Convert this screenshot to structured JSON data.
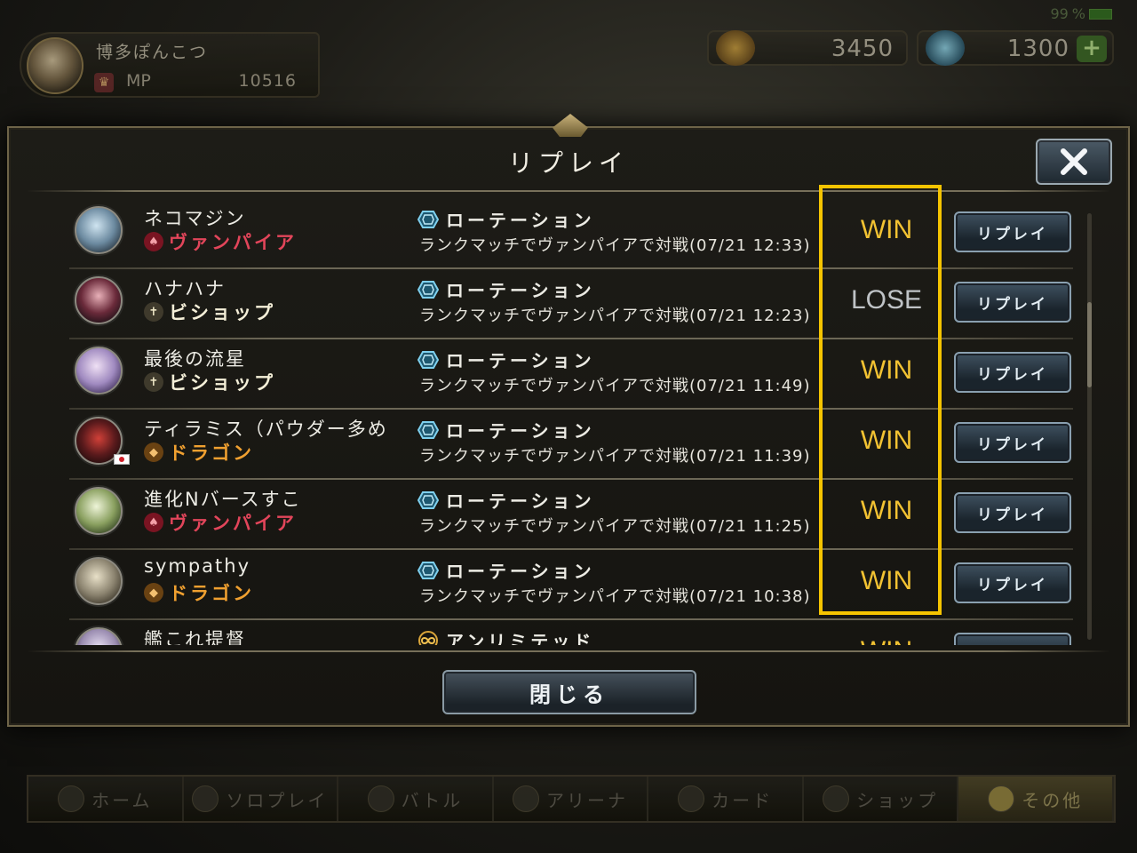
{
  "status": {
    "battery_percent": "99"
  },
  "profile": {
    "name": "博多ぽんこつ",
    "mp_label": "MP",
    "mp_value": "10516"
  },
  "currency": {
    "gold": "3450",
    "crystal": "1300",
    "plus": "+"
  },
  "modal": {
    "title": "リプレイ",
    "close_label": "閉じる",
    "rows": [
      {
        "player": "ネコマジン",
        "class_label": "ヴァンパイア",
        "class_type": "vampire",
        "format_label": "ローテーション",
        "format_type": "rotation",
        "description": "ランクマッチでヴァンパイアで対戦(07/21 12:33)",
        "result": "WIN",
        "replay_label": "リプレイ",
        "flag": false
      },
      {
        "player": "ハナハナ",
        "class_label": "ビショップ",
        "class_type": "bishop",
        "format_label": "ローテーション",
        "format_type": "rotation",
        "description": "ランクマッチでヴァンパイアで対戦(07/21 12:23)",
        "result": "LOSE",
        "replay_label": "リプレイ",
        "flag": false
      },
      {
        "player": "最後の流星",
        "class_label": "ビショップ",
        "class_type": "bishop",
        "format_label": "ローテーション",
        "format_type": "rotation",
        "description": "ランクマッチでヴァンパイアで対戦(07/21 11:49)",
        "result": "WIN",
        "replay_label": "リプレイ",
        "flag": false
      },
      {
        "player": "ティラミス（パウダー多め",
        "class_label": "ドラゴン",
        "class_type": "dragon",
        "format_label": "ローテーション",
        "format_type": "rotation",
        "description": "ランクマッチでヴァンパイアで対戦(07/21 11:39)",
        "result": "WIN",
        "replay_label": "リプレイ",
        "flag": true
      },
      {
        "player": "進化Nバースすこ",
        "class_label": "ヴァンパイア",
        "class_type": "vampire",
        "format_label": "ローテーション",
        "format_type": "rotation",
        "description": "ランクマッチでヴァンパイアで対戦(07/21 11:25)",
        "result": "WIN",
        "replay_label": "リプレイ",
        "flag": false
      },
      {
        "player": "sympathy",
        "class_label": "ドラゴン",
        "class_type": "dragon",
        "format_label": "ローテーション",
        "format_type": "rotation",
        "description": "ランクマッチでヴァンパイアで対戦(07/21 10:38)",
        "result": "WIN",
        "replay_label": "リプレイ",
        "flag": false
      },
      {
        "player": "艦これ提督",
        "class_label": "",
        "class_type": "",
        "format_label": "アンリミテッド",
        "format_type": "unlimited",
        "description": "",
        "result": "WIN",
        "replay_label": "リプレイ",
        "flag": false
      }
    ]
  },
  "bottom_nav": [
    {
      "label": "ホーム",
      "icon": "home-icon",
      "active": false
    },
    {
      "label": "ソロプレイ",
      "icon": "solo-play-icon",
      "active": false
    },
    {
      "label": "バトル",
      "icon": "battle-icon",
      "active": false
    },
    {
      "label": "アリーナ",
      "icon": "arena-icon",
      "active": false
    },
    {
      "label": "カード",
      "icon": "card-icon",
      "active": false
    },
    {
      "label": "ショップ",
      "icon": "shop-icon",
      "active": false
    },
    {
      "label": "その他",
      "icon": "other-icon",
      "active": true
    }
  ],
  "colors": {
    "win": "#f2c232",
    "lose": "#bfc3c6",
    "highlight": "#f5c400",
    "vampire": "#e2455a",
    "dragon": "#f0a030",
    "bishop": "#f4efd8"
  }
}
